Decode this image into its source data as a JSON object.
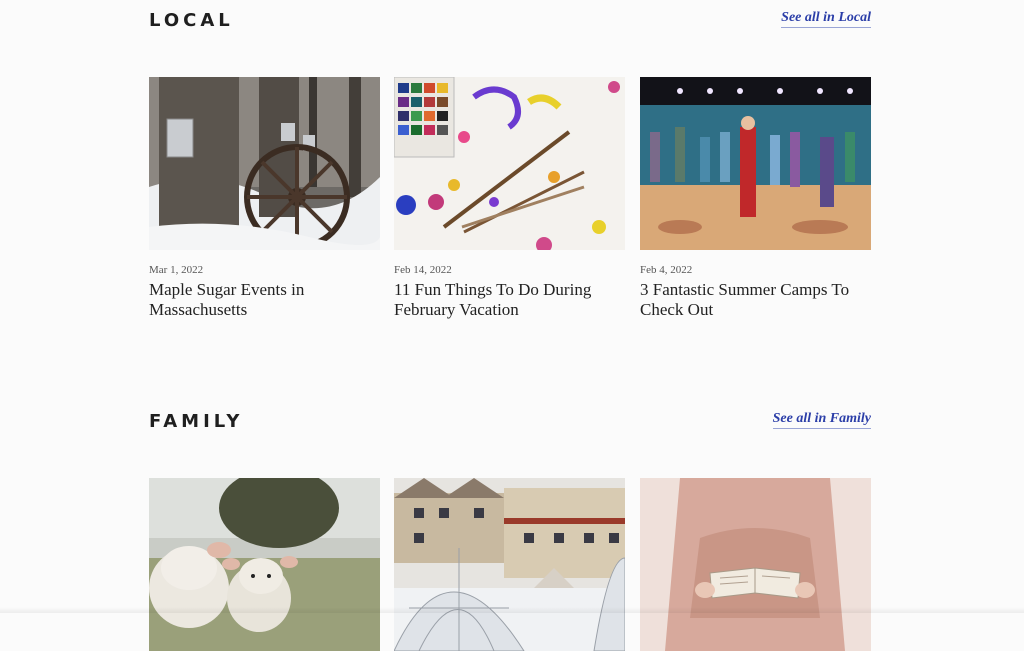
{
  "local": {
    "heading": "LOCAL",
    "see_all": "See all in Local",
    "cards": [
      {
        "date": "Mar 1, 2022",
        "title": "Maple Sugar Events in Massachusetts",
        "image": "maple-sap-buckets-wagon-wheel-snow"
      },
      {
        "date": "Feb 14, 2022",
        "title": "11 Fun Things To Do During February Vacation",
        "image": "watercolor-paints-brushes"
      },
      {
        "date": "Feb 4, 2022",
        "title": "3 Fantastic Summer Camps To Check Out",
        "image": "kids-theater-stage-performance"
      }
    ]
  },
  "family": {
    "heading": "FAMILY",
    "see_all": "See all in Family",
    "cards": [
      {
        "image": "lambs-in-field"
      },
      {
        "image": "snowy-inn-geodesic-domes"
      },
      {
        "image": "child-reading-book"
      }
    ]
  },
  "colors": {
    "link": "#2b3ea8",
    "heading": "#1f1f1f",
    "background": "#fbfbfb"
  }
}
